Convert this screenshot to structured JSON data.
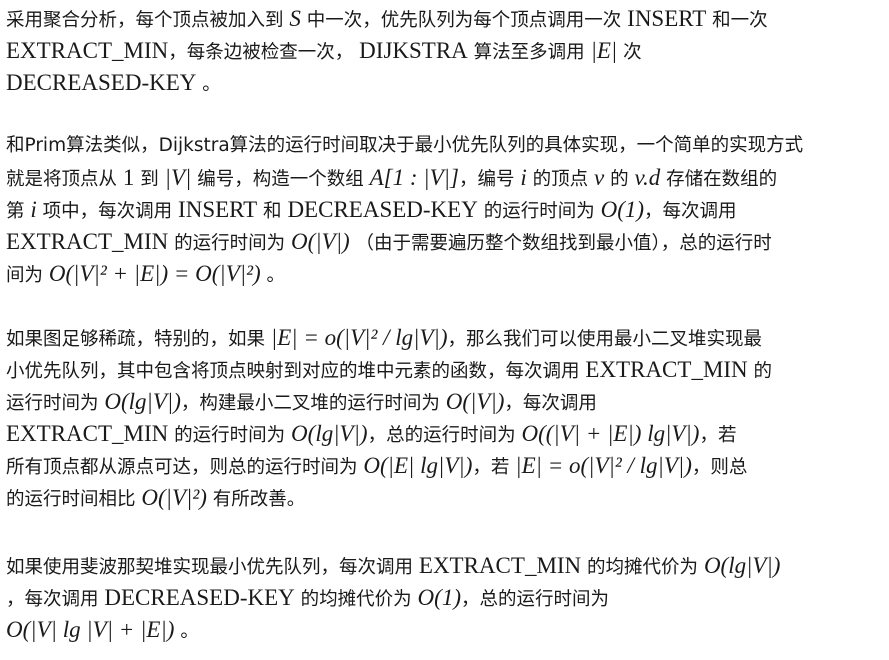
{
  "paragraphs": [
    {
      "lines": [
        [
          {
            "t": "采用聚合分析，每个顶点被加入到 ",
            "k": "text"
          },
          {
            "t": "S",
            "k": "mi"
          },
          {
            "t": " 中一次，优先队列为每个顶点调用一次 ",
            "k": "text"
          },
          {
            "t": "INSERT",
            "k": "m"
          },
          {
            "t": " 和一次",
            "k": "text"
          }
        ],
        [
          {
            "t": "EXTRACT_MIN",
            "k": "m"
          },
          {
            "t": "，每条边被检查一次， ",
            "k": "text"
          },
          {
            "t": "DIJKSTRA",
            "k": "m"
          },
          {
            "t": " 算法至多调用 ",
            "k": "text"
          },
          {
            "t": "|E|",
            "k": "mi"
          },
          {
            "t": " 次",
            "k": "text"
          }
        ],
        [
          {
            "t": "DECREASED-KEY",
            "k": "m"
          },
          {
            "t": " 。",
            "k": "text"
          }
        ]
      ]
    },
    {
      "lines": [
        [
          {
            "t": "和Prim算法类似，Dijkstra算法的运行时间取决于最小优先队列的具体实现，一个简单的实现方式",
            "k": "text"
          }
        ],
        [
          {
            "t": "就是将顶点从 ",
            "k": "text"
          },
          {
            "t": "1",
            "k": "m"
          },
          {
            "t": " 到 ",
            "k": "text"
          },
          {
            "t": "|V|",
            "k": "mi"
          },
          {
            "t": " 编号，构造一个数组 ",
            "k": "text"
          },
          {
            "t": "A[1 : |V|]",
            "k": "mi"
          },
          {
            "t": "，编号 ",
            "k": "text"
          },
          {
            "t": "i",
            "k": "mi"
          },
          {
            "t": " 的顶点 ",
            "k": "text"
          },
          {
            "t": "v",
            "k": "mi"
          },
          {
            "t": " 的 ",
            "k": "text"
          },
          {
            "t": "v.d",
            "k": "mi"
          },
          {
            "t": " 存储在数组的",
            "k": "text"
          }
        ],
        [
          {
            "t": "第 ",
            "k": "text"
          },
          {
            "t": "i",
            "k": "mi"
          },
          {
            "t": " 项中，每次调用 ",
            "k": "text"
          },
          {
            "t": "INSERT",
            "k": "m"
          },
          {
            "t": " 和 ",
            "k": "text"
          },
          {
            "t": "DECREASED-KEY",
            "k": "m"
          },
          {
            "t": " 的运行时间为 ",
            "k": "text"
          },
          {
            "t": "O(1)",
            "k": "mi"
          },
          {
            "t": "，每次调用",
            "k": "text"
          }
        ],
        [
          {
            "t": "EXTRACT_MIN",
            "k": "m"
          },
          {
            "t": " 的运行时间为 ",
            "k": "text"
          },
          {
            "t": "O(|V|)",
            "k": "mi"
          },
          {
            "t": " （由于需要遍历整个数组找到最小值），总的运行时",
            "k": "text"
          }
        ],
        [
          {
            "t": "间为 ",
            "k": "text"
          },
          {
            "t": "O(|V|² + |E|) = O(|V|²)",
            "k": "mi"
          },
          {
            "t": " 。",
            "k": "text"
          }
        ]
      ]
    },
    {
      "lines": [
        [
          {
            "t": "如果图足够稀疏，特别的，如果 ",
            "k": "text"
          },
          {
            "t": "|E| = o(|V|² / lg|V|)",
            "k": "mi"
          },
          {
            "t": "，那么我们可以使用最小二叉堆实现最",
            "k": "text"
          }
        ],
        [
          {
            "t": "小优先队列，其中包含将顶点映射到对应的堆中元素的函数，每次调用 ",
            "k": "text"
          },
          {
            "t": "EXTRACT_MIN",
            "k": "m"
          },
          {
            "t": " 的",
            "k": "text"
          }
        ],
        [
          {
            "t": "运行时间为 ",
            "k": "text"
          },
          {
            "t": "O(lg|V|)",
            "k": "mi"
          },
          {
            "t": "，构建最小二叉堆的运行时间为 ",
            "k": "text"
          },
          {
            "t": "O(|V|)",
            "k": "mi"
          },
          {
            "t": "，每次调用",
            "k": "text"
          }
        ],
        [
          {
            "t": "EXTRACT_MIN",
            "k": "m"
          },
          {
            "t": " 的运行时间为 ",
            "k": "text"
          },
          {
            "t": "O(lg|V|)",
            "k": "mi"
          },
          {
            "t": "，总的运行时间为 ",
            "k": "text"
          },
          {
            "t": "O((|V| + |E|) lg|V|)",
            "k": "mi"
          },
          {
            "t": "，若",
            "k": "text"
          }
        ],
        [
          {
            "t": "所有顶点都从源点可达，则总的运行时间为 ",
            "k": "text"
          },
          {
            "t": "O(|E| lg|V|)",
            "k": "mi"
          },
          {
            "t": "，若 ",
            "k": "text"
          },
          {
            "t": "|E| = o(|V|² / lg|V|)",
            "k": "mi"
          },
          {
            "t": "，则总",
            "k": "text"
          }
        ],
        [
          {
            "t": "的运行时间相比 ",
            "k": "text"
          },
          {
            "t": "O(|V|²)",
            "k": "mi"
          },
          {
            "t": " 有所改善。",
            "k": "text"
          }
        ]
      ]
    },
    {
      "lines": [
        [
          {
            "t": "如果使用斐波那契堆实现最小优先队列，每次调用 ",
            "k": "text"
          },
          {
            "t": "EXTRACT_MIN",
            "k": "m"
          },
          {
            "t": " 的均摊代价为 ",
            "k": "text"
          },
          {
            "t": "O(lg|V|)",
            "k": "mi"
          }
        ],
        [
          {
            "t": "，每次调用 ",
            "k": "text"
          },
          {
            "t": "DECREASED-KEY",
            "k": "m"
          },
          {
            "t": " 的均摊代价为 ",
            "k": "text"
          },
          {
            "t": "O(1)",
            "k": "mi"
          },
          {
            "t": "，总的运行时间为",
            "k": "text"
          }
        ],
        [
          {
            "t": "O(|V| lg |V| + |E|)",
            "k": "mi"
          },
          {
            "t": " 。",
            "k": "text"
          }
        ]
      ]
    }
  ]
}
